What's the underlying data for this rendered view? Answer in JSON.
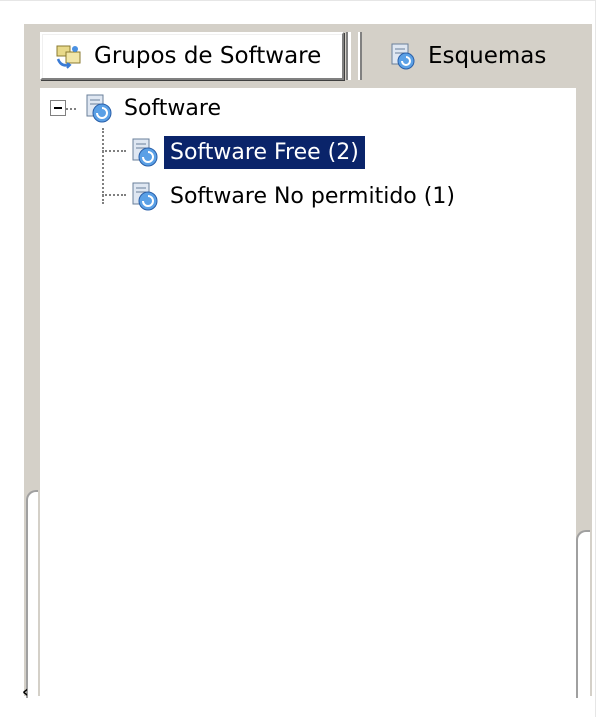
{
  "tabs": [
    {
      "label": "Grupos de Software",
      "icon": "software-groups-icon",
      "active": true
    },
    {
      "label": "Esquemas",
      "icon": "schemes-icon",
      "active": false
    }
  ],
  "tree": {
    "root": {
      "label": "Software",
      "icon": "software-icon",
      "expanded": true
    },
    "children": [
      {
        "label": "Software Free  (2)",
        "icon": "software-icon",
        "selected": true
      },
      {
        "label": "Software No permitido  (1)",
        "icon": "software-icon",
        "selected": false
      }
    ]
  },
  "colors": {
    "panel_bg": "#d4d0c8",
    "selection_bg": "#0a246a",
    "selection_fg": "#ffffff"
  }
}
